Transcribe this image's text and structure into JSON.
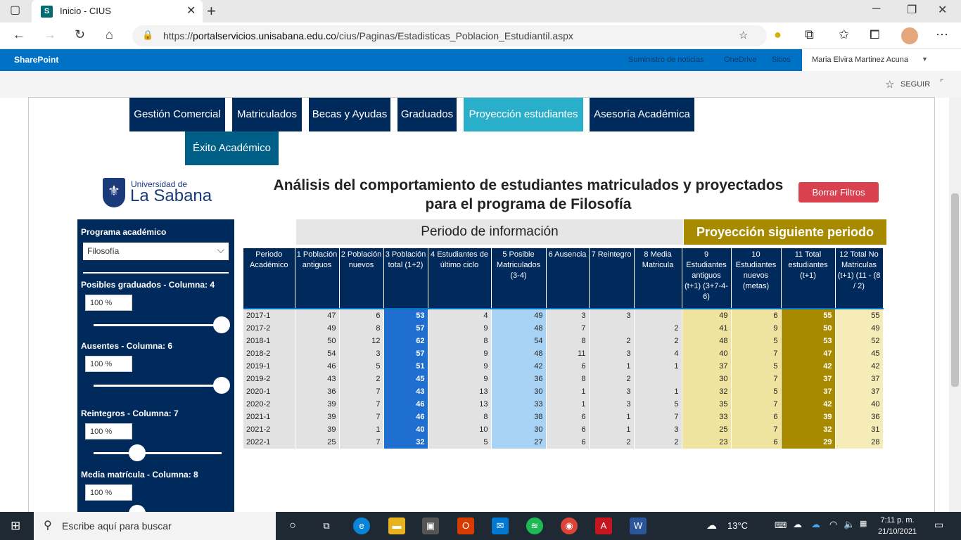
{
  "browser": {
    "tab_title": "Inicio - CIUS",
    "tab_favicon": "S",
    "url_prefix": "https://",
    "url_host": "portalservicios.unisabana.edu.co",
    "url_path": "/cius/Paginas/Estadisticas_Poblacion_Estudiantil.aspx"
  },
  "sharepoint": {
    "title": "SharePoint",
    "links": [
      "Suministro de noticias",
      "OneDrive",
      "Sitios"
    ],
    "user": "Maria Elvira Martinez Acuna",
    "follow": "SEGUIR"
  },
  "nav": {
    "buttons": [
      "Gestión Comercial",
      "Matriculados",
      "Becas y Ayudas",
      "Graduados",
      "Proyección estudiantes",
      "Asesoría Académica",
      "Éxito Académico"
    ]
  },
  "logo": {
    "small": "Universidad de",
    "big": "La Sabana"
  },
  "report": {
    "title_line1": "Análisis del comportamiento de estudiantes matriculados y proyectados",
    "title_line2": "para el programa de Filosofía",
    "clear_filters": "Borrar Filtros"
  },
  "sidebar": {
    "program_label": "Programa académico",
    "program_value": "Filosofía",
    "graduados_label": "Posibles graduados - Columna: 4",
    "graduados_value": "100 %",
    "ausentes_label": "Ausentes - Columna: 6",
    "ausentes_value": "100 %",
    "reintegros_label": "Reintegros - Columna: 7",
    "reintegros_value": "100 %",
    "media_label": "Media matrícula - Columna: 8",
    "media_value": "100 %"
  },
  "table": {
    "group_periodo": "Periodo de información",
    "group_proyeccion": "Proyección siguiente periodo",
    "headers": [
      "Periodo Académico",
      "1 Población antiguos",
      "2 Población nuevos",
      "3 Población total (1+2)",
      "4 Estudiantes de último ciclo",
      "5 Posible Matriculados (3-4)",
      "6 Ausencia",
      "7 Reintegro",
      "8 Media Matricula",
      "9 Estudiantes antiguos (t+1) (3+7-4-6)",
      "10 Estudiantes nuevos (metas)",
      "11 Total estudiantes (t+1)",
      "12 Total No Matriculas (t+1) (11 - (8 / 2)"
    ],
    "rows": [
      [
        "2017-1",
        "47",
        "6",
        "53",
        "4",
        "49",
        "3",
        "3",
        "",
        "49",
        "6",
        "55",
        "55"
      ],
      [
        "2017-2",
        "49",
        "8",
        "57",
        "9",
        "48",
        "7",
        "",
        "2",
        "41",
        "9",
        "50",
        "49"
      ],
      [
        "2018-1",
        "50",
        "12",
        "62",
        "8",
        "54",
        "8",
        "2",
        "2",
        "48",
        "5",
        "53",
        "52"
      ],
      [
        "2018-2",
        "54",
        "3",
        "57",
        "9",
        "48",
        "11",
        "3",
        "4",
        "40",
        "7",
        "47",
        "45"
      ],
      [
        "2019-1",
        "46",
        "5",
        "51",
        "9",
        "42",
        "6",
        "1",
        "1",
        "37",
        "5",
        "42",
        "42"
      ],
      [
        "2019-2",
        "43",
        "2",
        "45",
        "9",
        "36",
        "8",
        "2",
        "",
        "30",
        "7",
        "37",
        "37"
      ],
      [
        "2020-1",
        "36",
        "7",
        "43",
        "13",
        "30",
        "1",
        "3",
        "1",
        "32",
        "5",
        "37",
        "37"
      ],
      [
        "2020-2",
        "39",
        "7",
        "46",
        "13",
        "33",
        "1",
        "3",
        "5",
        "35",
        "7",
        "42",
        "40"
      ],
      [
        "2021-1",
        "39",
        "7",
        "46",
        "8",
        "38",
        "6",
        "1",
        "7",
        "33",
        "6",
        "39",
        "36"
      ],
      [
        "2021-2",
        "39",
        "1",
        "40",
        "10",
        "30",
        "6",
        "1",
        "3",
        "25",
        "7",
        "32",
        "31"
      ],
      [
        "2022-1",
        "25",
        "7",
        "32",
        "5",
        "27",
        "6",
        "2",
        "2",
        "23",
        "6",
        "29",
        "28"
      ]
    ]
  },
  "taskbar": {
    "search": "Escribe aquí para buscar",
    "temp": "13°C",
    "time": "7:11 p. m.",
    "date": "21/10/2021"
  },
  "colors": {
    "navy": "#002a5c",
    "active": "#29afc9",
    "gold": "#a88a00",
    "red": "#d9414f",
    "sp_blue": "#0072c6"
  }
}
